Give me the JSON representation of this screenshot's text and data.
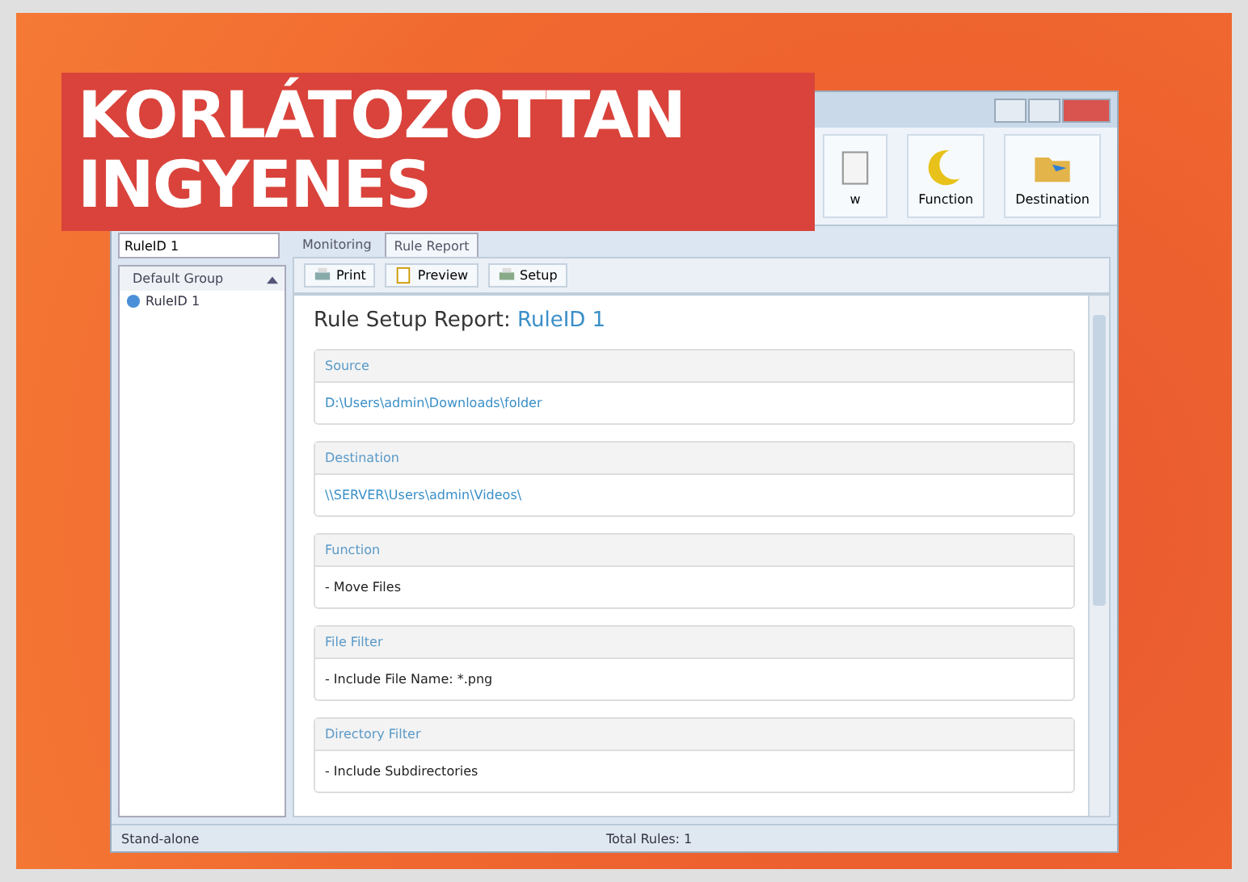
{
  "banner": {
    "lines": [
      "KORLÁTOZOTTAN",
      "INGYENES"
    ]
  },
  "toolbar": {
    "buttons": [
      {
        "label": "w",
        "kind": "partial"
      },
      {
        "label": "Function",
        "kind": "function"
      },
      {
        "label": "Destination",
        "kind": "destination"
      }
    ]
  },
  "sidebar": {
    "search": {
      "value": "RuleID 1"
    },
    "group": "Default Group",
    "items": [
      {
        "label": "RuleID 1"
      }
    ]
  },
  "tabs": [
    {
      "label": "Monitoring",
      "selected": false
    },
    {
      "label": "Rule Report",
      "selected": true
    }
  ],
  "report_toolbar": [
    {
      "label": "Print",
      "kind": "print"
    },
    {
      "label": "Preview",
      "kind": "preview"
    },
    {
      "label": "Setup",
      "kind": "setup"
    }
  ],
  "report": {
    "title": "Rule Setup Report:",
    "rule": "RuleID 1",
    "sections": [
      {
        "heading": "Source",
        "value": "D:\\Users\\admin\\Downloads\\folder",
        "kind": "path"
      },
      {
        "heading": "Destination",
        "value": "\\\\SERVER\\Users\\admin\\Videos\\",
        "kind": "path"
      },
      {
        "heading": "Function",
        "value": "- Move Files",
        "kind": "plain"
      },
      {
        "heading": "File Filter",
        "value": "- Include File Name: *.png",
        "kind": "plain"
      },
      {
        "heading": "Directory Filter",
        "value": "- Include Subdirectories",
        "kind": "plain"
      }
    ]
  },
  "status_bar": {
    "left": "Stand-alone",
    "center": "Total Rules: 1"
  }
}
